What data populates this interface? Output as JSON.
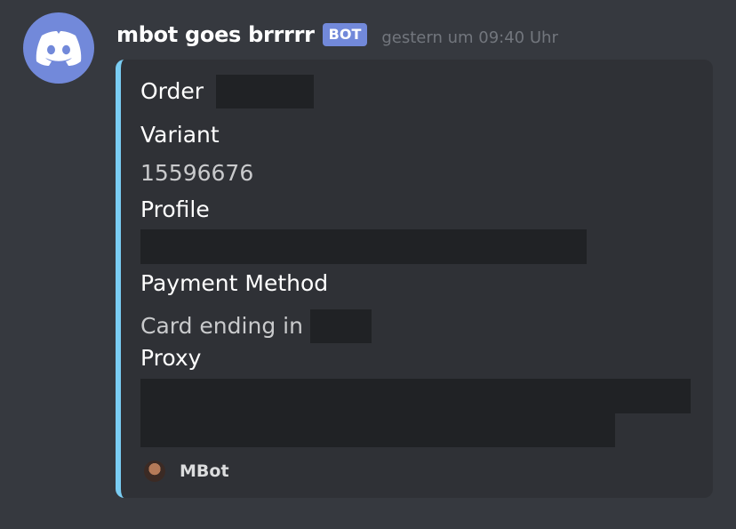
{
  "message": {
    "author": "mbot goes brrrrr",
    "badge": "BOT",
    "timestamp": "gestern um 09:40 Uhr",
    "avatar_icon": "discord-logo-icon",
    "avatar_color": "#7289da"
  },
  "embed": {
    "accent_color": "#7acdf3",
    "title": "Order",
    "fields": [
      {
        "name": "Variant",
        "value": "15596676"
      },
      {
        "name": "Profile",
        "value": ""
      },
      {
        "name": "Payment Method",
        "value": "Card ending in"
      },
      {
        "name": "Proxy",
        "value": ""
      }
    ],
    "footer": {
      "text": "MBot",
      "icon": "mbot-avatar-icon"
    }
  }
}
